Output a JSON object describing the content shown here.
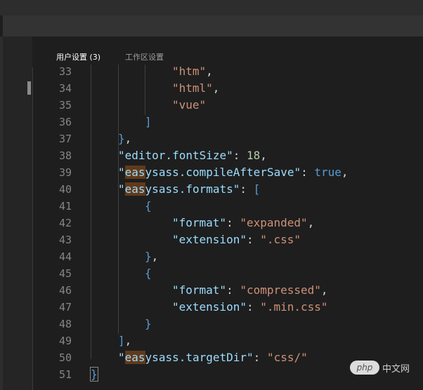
{
  "tabs": [
    {
      "label": "用户设置 (3)",
      "active": true
    },
    {
      "label": "工作区设置",
      "active": false
    }
  ],
  "code_lines": [
    {
      "num": "33",
      "indent": 3,
      "tokens": [
        {
          "t": "\"htm\"",
          "c": "s"
        },
        {
          "t": ",",
          "c": "p"
        }
      ]
    },
    {
      "num": "34",
      "indent": 3,
      "tokens": [
        {
          "t": "\"html\"",
          "c": "s"
        },
        {
          "t": ",",
          "c": "p"
        }
      ]
    },
    {
      "num": "35",
      "indent": 3,
      "tokens": [
        {
          "t": "\"vue\"",
          "c": "s"
        }
      ]
    },
    {
      "num": "36",
      "indent": 2,
      "tokens": [
        {
          "t": "]",
          "c": "b"
        }
      ]
    },
    {
      "num": "37",
      "indent": 1,
      "tokens": [
        {
          "t": "}",
          "c": "b"
        },
        {
          "t": ",",
          "c": "p"
        }
      ]
    },
    {
      "num": "38",
      "indent": 1,
      "tokens": [
        {
          "t": "\"editor.fontSize\"",
          "c": "k"
        },
        {
          "t": ": ",
          "c": "p"
        },
        {
          "t": "18",
          "c": "n"
        },
        {
          "t": ",",
          "c": "p"
        }
      ]
    },
    {
      "num": "39",
      "indent": 1,
      "tokens": [
        {
          "t": "\"",
          "c": "k"
        },
        {
          "t": "eas",
          "c": "k",
          "hl": true
        },
        {
          "t": "ysass.compileAfterSave\"",
          "c": "k"
        },
        {
          "t": ": ",
          "c": "p"
        },
        {
          "t": "true",
          "c": "b"
        },
        {
          "t": ",",
          "c": "p"
        }
      ]
    },
    {
      "num": "40",
      "indent": 1,
      "tokens": [
        {
          "t": "\"",
          "c": "k"
        },
        {
          "t": "eas",
          "c": "k",
          "hl": true
        },
        {
          "t": "ysass.formats\"",
          "c": "k"
        },
        {
          "t": ": ",
          "c": "p"
        },
        {
          "t": "[",
          "c": "b"
        }
      ]
    },
    {
      "num": "41",
      "indent": 2,
      "tokens": [
        {
          "t": "{",
          "c": "b"
        }
      ]
    },
    {
      "num": "42",
      "indent": 3,
      "tokens": [
        {
          "t": "\"format\"",
          "c": "k"
        },
        {
          "t": ": ",
          "c": "p"
        },
        {
          "t": "\"expanded\"",
          "c": "s"
        },
        {
          "t": ",",
          "c": "p"
        }
      ]
    },
    {
      "num": "43",
      "indent": 3,
      "tokens": [
        {
          "t": "\"extension\"",
          "c": "k"
        },
        {
          "t": ": ",
          "c": "p"
        },
        {
          "t": "\".css\"",
          "c": "s"
        }
      ]
    },
    {
      "num": "44",
      "indent": 2,
      "tokens": [
        {
          "t": "}",
          "c": "b"
        },
        {
          "t": ",",
          "c": "p"
        }
      ]
    },
    {
      "num": "45",
      "indent": 2,
      "tokens": [
        {
          "t": "{",
          "c": "b"
        }
      ]
    },
    {
      "num": "46",
      "indent": 3,
      "tokens": [
        {
          "t": "\"format\"",
          "c": "k"
        },
        {
          "t": ": ",
          "c": "p"
        },
        {
          "t": "\"compressed\"",
          "c": "s"
        },
        {
          "t": ",",
          "c": "p"
        }
      ]
    },
    {
      "num": "47",
      "indent": 3,
      "tokens": [
        {
          "t": "\"extension\"",
          "c": "k"
        },
        {
          "t": ": ",
          "c": "p"
        },
        {
          "t": "\".min.css\"",
          "c": "s"
        }
      ]
    },
    {
      "num": "48",
      "indent": 2,
      "tokens": [
        {
          "t": "}",
          "c": "b"
        }
      ]
    },
    {
      "num": "49",
      "indent": 1,
      "tokens": [
        {
          "t": "]",
          "c": "b"
        },
        {
          "t": ",",
          "c": "p"
        }
      ]
    },
    {
      "num": "50",
      "indent": 1,
      "tokens": [
        {
          "t": "\"",
          "c": "k"
        },
        {
          "t": "eas",
          "c": "k",
          "hl": true
        },
        {
          "t": "ysass.targetDir\"",
          "c": "k"
        },
        {
          "t": ": ",
          "c": "p"
        },
        {
          "t": "\"css/\"",
          "c": "s"
        }
      ]
    },
    {
      "num": "51",
      "indent": 0,
      "tokens": [
        {
          "t": "}",
          "c": "b",
          "match": true
        }
      ]
    }
  ],
  "watermark": {
    "badge": "php",
    "text": "中文网"
  },
  "colors": {
    "key": "#9cdcfe",
    "string": "#ce9178",
    "number": "#b5cea8",
    "keyword": "#569cd6",
    "punctuation": "#d4d4d4",
    "find_highlight": "#613a1a",
    "background": "#1e1e1e"
  }
}
